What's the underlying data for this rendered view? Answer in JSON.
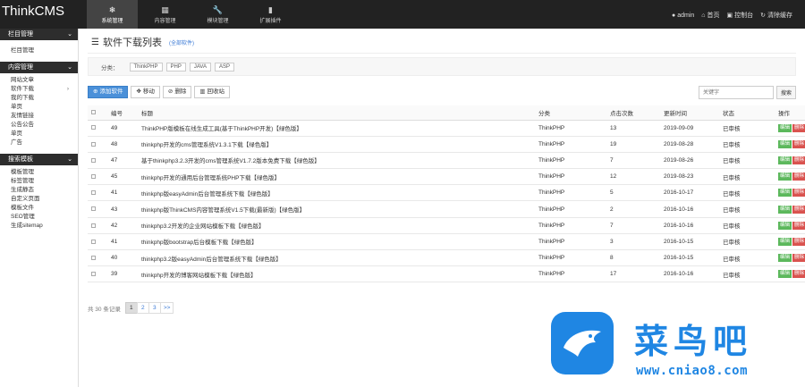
{
  "app": {
    "brand": "ThinkCMS"
  },
  "topnav": [
    {
      "label": "系统管理",
      "icon": "❄",
      "active": true
    },
    {
      "label": "内容管理",
      "icon": "▦",
      "active": false
    },
    {
      "label": "模块管理",
      "icon": "🔧",
      "active": false
    },
    {
      "label": "扩展插件",
      "icon": "▮",
      "active": false
    }
  ],
  "topright": {
    "user": "admin",
    "home": "首页",
    "console": "控制台",
    "clear_cache": "清除缓存"
  },
  "sidebar": {
    "groups": [
      {
        "title": "栏目管理",
        "items": [
          "栏目管理"
        ]
      },
      {
        "title": "内容管理",
        "items": [
          "网站文章",
          "软件下载",
          "我的下载",
          "单页",
          "友情链接",
          "公告公告",
          "单页",
          "广告"
        ]
      },
      {
        "title": "搜索模板",
        "items": [
          "模板管理",
          "标签管理",
          "生成静态",
          "自定义页面",
          "模板文件",
          "SEO管理",
          "生成sitemap"
        ]
      }
    ]
  },
  "page": {
    "title": "软件下载列表",
    "subtitle": "(全部软件)"
  },
  "filter": {
    "label": "分类：",
    "chips": [
      "ThinkPHP",
      "PHP",
      "JAVA",
      "ASP"
    ]
  },
  "toolbar": {
    "add": "添加软件",
    "move": "移动",
    "delete": "删除",
    "recycle": "回收站"
  },
  "search": {
    "placeholder": "关键字",
    "button": "搜索"
  },
  "table": {
    "headers": [
      "",
      "编号",
      "标题",
      "分类",
      "点击次数",
      "更新时间",
      "状态",
      "操作"
    ],
    "rows": [
      {
        "id": "49",
        "title": "ThinkPHP版模板在线生成工具(基于ThinkPHP开发)【绿色版】",
        "category": "ThinkPHP",
        "hits": "13",
        "date": "2019-09-09",
        "status": "已审核"
      },
      {
        "id": "48",
        "title": "thinkphp开发的cms管理系统V1.3.1下载【绿色版】",
        "category": "ThinkPHP",
        "hits": "19",
        "date": "2019-08-28",
        "status": "已审核"
      },
      {
        "id": "47",
        "title": "基于thinkphp3.2.3开发的cms管理系统V1.7.2版本免费下载【绿色版】",
        "category": "ThinkPHP",
        "hits": "7",
        "date": "2019-08-26",
        "status": "已审核"
      },
      {
        "id": "45",
        "title": "thinkphp开发的通用后台管理系统PHP下载【绿色版】",
        "category": "ThinkPHP",
        "hits": "12",
        "date": "2019-08-23",
        "status": "已审核"
      },
      {
        "id": "41",
        "title": "thinkphp版easyAdmin后台管理系统下载【绿色版】",
        "category": "ThinkPHP",
        "hits": "5",
        "date": "2016-10-17",
        "status": "已审核"
      },
      {
        "id": "43",
        "title": "thinkphp版ThinkCMS内容管理系统V1.5下载(最新版)【绿色版】",
        "category": "ThinkPHP",
        "hits": "2",
        "date": "2016-10-16",
        "status": "已审核"
      },
      {
        "id": "42",
        "title": "thinkphp3.2开发的企业网站模板下载【绿色版】",
        "category": "ThinkPHP",
        "hits": "7",
        "date": "2016-10-16",
        "status": "已审核"
      },
      {
        "id": "41",
        "title": "thinkphp版bootstrap后台模板下载【绿色版】",
        "category": "ThinkPHP",
        "hits": "3",
        "date": "2016-10-15",
        "status": "已审核"
      },
      {
        "id": "40",
        "title": "thinkphp3.2版easyAdmin后台管理系统下载【绿色版】",
        "category": "ThinkPHP",
        "hits": "8",
        "date": "2016-10-15",
        "status": "已审核"
      },
      {
        "id": "39",
        "title": "thinkphp开发的博客网站模板下载【绿色版】",
        "category": "ThinkPHP",
        "hits": "17",
        "date": "2016-10-16",
        "status": "已审核"
      }
    ],
    "actions": {
      "edit": "编辑",
      "delete": "删除"
    }
  },
  "pager": {
    "info": "共 30 条记录",
    "pages": [
      "1",
      "2",
      "3",
      ">>"
    ],
    "current": "1"
  },
  "watermark": {
    "name": "菜鸟吧",
    "url": "www.cniao8.com"
  },
  "colors": {
    "topbar": "#222222",
    "sidebar_head": "#2d2d2d",
    "primary": "#4a90d9",
    "success": "#5cb85c",
    "danger": "#d9534f",
    "watermark": "#1f86e3"
  }
}
